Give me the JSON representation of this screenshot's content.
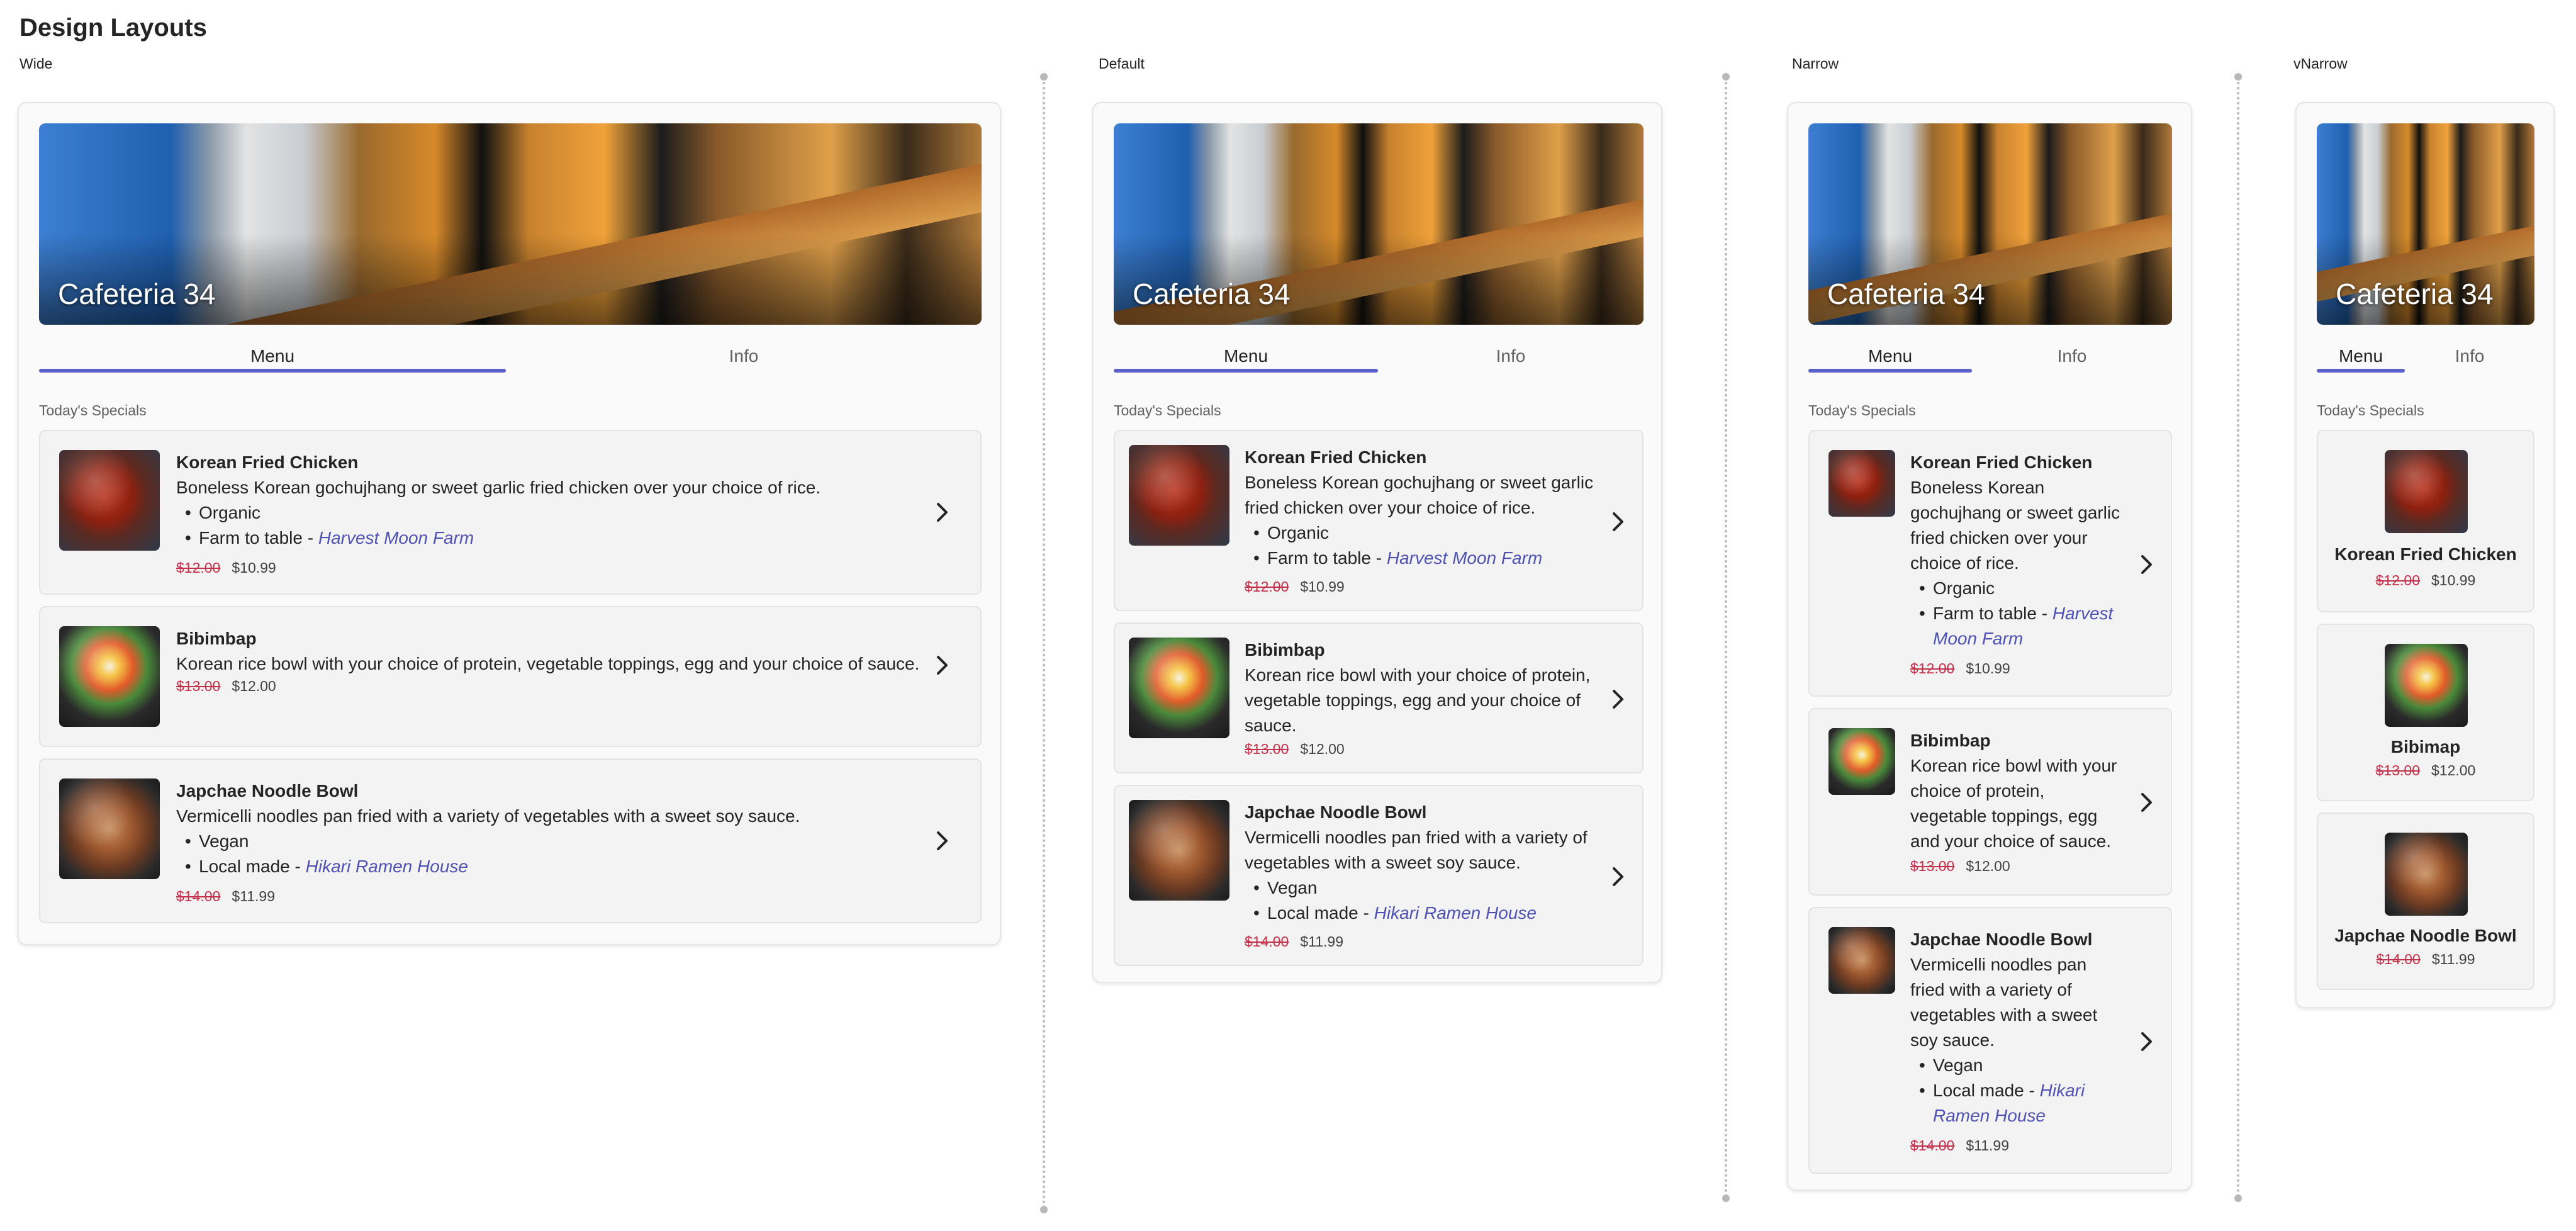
{
  "page_title": "Design Layouts",
  "layouts": {
    "wide": {
      "label": "Wide"
    },
    "default": {
      "label": "Default"
    },
    "narrow": {
      "label": "Narrow"
    },
    "vnarrow": {
      "label": "vNarrow"
    }
  },
  "card": {
    "title": "Cafeteria 34",
    "tabs": [
      "Menu",
      "Info"
    ],
    "active_tab": "Menu",
    "section_label": "Today's Specials"
  },
  "items": [
    {
      "name": "Korean Fried Chicken",
      "short_name": "Korean Fried Chicken",
      "description": "Boneless Korean gochujhang or sweet garlic fried chicken over your choice of rice.",
      "tag1": "Organic",
      "tag2_prefix": "Farm to table - ",
      "tag2_link": "Harvest Moon Farm",
      "old_price": "$12.00",
      "price": "$10.99",
      "image": "korean-fried-chicken-photo"
    },
    {
      "name": "Bibimbap",
      "short_name": "Bibimap",
      "description": "Korean rice bowl with your choice of protein, vegetable toppings, egg and your choice of sauce.",
      "old_price": "$13.00",
      "price": "$12.00",
      "image": "bibimbap-photo"
    },
    {
      "name": "Japchae Noodle Bowl",
      "short_name": "Japchae Noodle Bowl",
      "description": "Vermicelli noodles pan fried with a variety of vegetables with a sweet soy sauce.",
      "tag1": "Vegan",
      "tag2_prefix": "Local made - ",
      "tag2_link": "Hikari Ramen House",
      "old_price": "$14.00",
      "price": "$11.99",
      "image": "japchae-photo"
    }
  ],
  "colors": {
    "accent": "#5b5fc7",
    "link": "#4f52b2",
    "strike_price": "#c4314b",
    "card_bg": "#fafafa",
    "item_bg": "#f3f3f3"
  },
  "icons": {
    "chevron": "chevron-right-icon"
  }
}
